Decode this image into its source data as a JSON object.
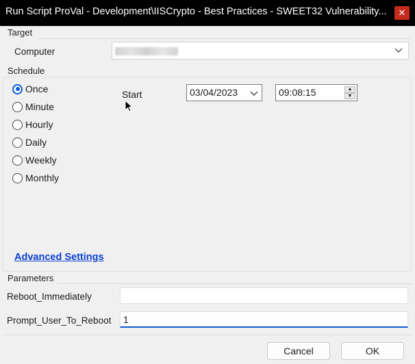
{
  "window": {
    "title": "Run Script ProVal - Development\\IISCrypto - Best Practices - SWEET32 Vulnerability...",
    "close_symbol": "✕"
  },
  "target": {
    "section_label": "Target",
    "computer_label": "Computer",
    "computer_value": ""
  },
  "schedule": {
    "section_label": "Schedule",
    "options": [
      {
        "label": "Once",
        "checked": true
      },
      {
        "label": "Minute",
        "checked": false
      },
      {
        "label": "Hourly",
        "checked": false
      },
      {
        "label": "Daily",
        "checked": false
      },
      {
        "label": "Weekly",
        "checked": false
      },
      {
        "label": "Monthly",
        "checked": false
      }
    ],
    "start_label": "Start",
    "start_date": "03/04/2023",
    "start_time": "09:08:15"
  },
  "advanced_settings_label": "Advanced Settings",
  "parameters": {
    "section_label": "Parameters",
    "items": [
      {
        "label": "Reboot_Immediately",
        "value": ""
      },
      {
        "label": "Prompt_User_To_Reboot",
        "value": "1"
      }
    ]
  },
  "buttons": {
    "cancel": "Cancel",
    "ok": "OK"
  },
  "colors": {
    "accent": "#0a5bd6",
    "link": "#0b3fd1",
    "close": "#c42b1c",
    "titlebar": "#000000"
  }
}
